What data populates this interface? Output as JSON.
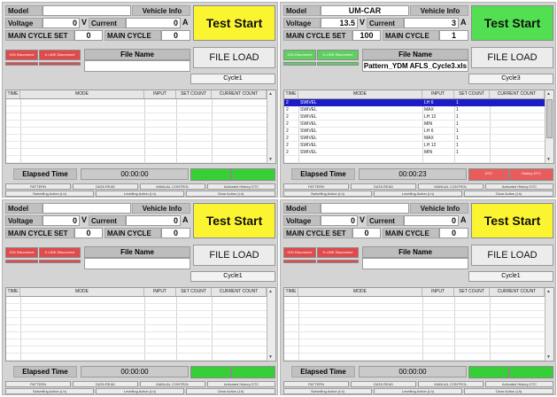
{
  "labels": {
    "model": "Model",
    "vehicle_info": "Vehicle Info",
    "voltage": "Voltage",
    "voltage_unit": "V",
    "current": "Current",
    "current_unit": "A",
    "main_cycle_set": "MAIN CYCLE SET",
    "main_cycle": "MAIN CYCLE",
    "test_start": "Test Start",
    "file_name": "File Name",
    "file_load": "FILE LOAD",
    "ign_disconnect": "IGN Disconnect",
    "kline_disconnect": "K-LINE Disconnect",
    "elapsed_time": "Elapsed Time",
    "table_headers": [
      "TIME",
      "MODE",
      "INPUT",
      "SET COUNT",
      "CURRENT COUNT"
    ],
    "buttons_row1": [
      "PATTERN",
      "DATA READ",
      "MANUAL CONTROL",
      "Activated History DTC"
    ],
    "buttons_row2": [
      "Swivelling Action (Lh)",
      "Levelling Action (Lh)",
      "Clear Action (Lh)"
    ]
  },
  "colors": {
    "test_start_idle": "#fbf531",
    "test_start_active": "#52e052",
    "disconnect_red": "#e04a4a",
    "disconnect_green": "#5fcf5f",
    "indicator_green": "#36cf36",
    "dtc_red": "#e85c5c",
    "selected_row": "#1d1dc8"
  },
  "panels": [
    {
      "model": "",
      "voltage": "0",
      "current": "0",
      "main_cycle_set": "0",
      "main_cycle": "0",
      "test_start_state": "idle",
      "disconnect_state": "red",
      "file_name": "",
      "cycle": "Cycle1",
      "elapsed": "00:00:00",
      "dtc_state": "green",
      "rows": []
    },
    {
      "model": "UM-CAR",
      "voltage": "13.5",
      "current": "3",
      "main_cycle_set": "100",
      "main_cycle": "1",
      "test_start_state": "active",
      "disconnect_state": "green",
      "file_name": "Pattern_YDM AFLS_Cycle3.xls",
      "cycle": "Cycle3",
      "elapsed": "00:00:23",
      "dtc_state": "red",
      "dtc_left": "DTC",
      "dtc_right": "History DTC",
      "rows": [
        {
          "time": "2",
          "mode": "SWIVEL",
          "input": "LH 6",
          "set_count": "1",
          "current_count": "",
          "selected": true
        },
        {
          "time": "2",
          "mode": "SWIVEL",
          "input": "MAX",
          "set_count": "1",
          "current_count": "",
          "selected": false
        },
        {
          "time": "2",
          "mode": "SWIVEL",
          "input": "LH 12",
          "set_count": "1",
          "current_count": "",
          "selected": false
        },
        {
          "time": "2",
          "mode": "SWIVEL",
          "input": "MIN",
          "set_count": "1",
          "current_count": "",
          "selected": false
        },
        {
          "time": "2",
          "mode": "SWIVEL",
          "input": "LH 6",
          "set_count": "1",
          "current_count": "",
          "selected": false
        },
        {
          "time": "2",
          "mode": "SWIVEL",
          "input": "MAX",
          "set_count": "1",
          "current_count": "",
          "selected": false
        },
        {
          "time": "2",
          "mode": "SWIVEL",
          "input": "LH 12",
          "set_count": "1",
          "current_count": "",
          "selected": false
        },
        {
          "time": "2",
          "mode": "SWIVEL",
          "input": "MIN",
          "set_count": "1",
          "current_count": "",
          "selected": false
        }
      ]
    },
    {
      "model": "",
      "voltage": "0",
      "current": "0",
      "main_cycle_set": "0",
      "main_cycle": "0",
      "test_start_state": "idle",
      "disconnect_state": "red",
      "file_name": "",
      "cycle": "Cycle1",
      "elapsed": "00:00:00",
      "dtc_state": "green",
      "rows": []
    },
    {
      "model": "",
      "voltage": "0",
      "current": "0",
      "main_cycle_set": "0",
      "main_cycle": "0",
      "test_start_state": "idle",
      "disconnect_state": "red",
      "file_name": "",
      "cycle": "Cycle1",
      "elapsed": "00:00:00",
      "dtc_state": "green",
      "rows": []
    }
  ]
}
